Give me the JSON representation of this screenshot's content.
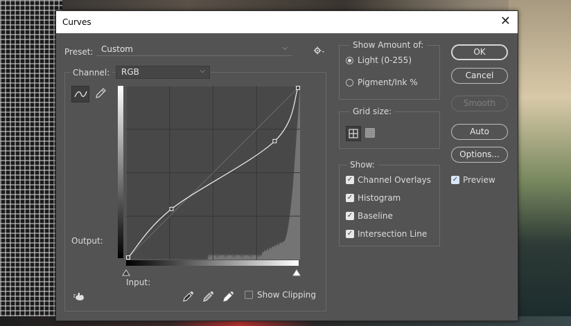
{
  "dialog": {
    "title": "Curves",
    "close_icon": "close-icon"
  },
  "preset": {
    "label": "Preset:",
    "value": "Custom",
    "settings_icon": "gear-icon"
  },
  "channel": {
    "label": "Channel:",
    "value": "RGB"
  },
  "curve": {
    "output_label": "Output:",
    "input_label": "Input:",
    "points": [
      [
        0,
        0
      ],
      [
        65,
        73
      ],
      [
        220,
        175
      ],
      [
        255,
        255
      ]
    ],
    "histogram_color": "#7d7d7d",
    "grid_divisions": 4,
    "tools": [
      "curve-point-tool-icon",
      "pencil-icon"
    ],
    "eyedroppers": [
      "black-eyedropper-icon",
      "gray-eyedropper-icon",
      "white-eyedropper-icon"
    ],
    "target_adjust_icon": "hand-adjust-icon",
    "show_clipping_label": "Show Clipping"
  },
  "show_amount": {
    "title": "Show Amount of:",
    "options": [
      "Light  (0-255)",
      "Pigment/Ink %"
    ],
    "selected": 0
  },
  "grid_size": {
    "title": "Grid size:",
    "options": [
      "simple-grid-icon",
      "detailed-grid-icon"
    ],
    "selected": 0
  },
  "show": {
    "title": "Show:",
    "items": [
      "Channel Overlays",
      "Histogram",
      "Baseline",
      "Intersection Line"
    ]
  },
  "buttons": {
    "ok": "OK",
    "cancel": "Cancel",
    "smooth": "Smooth",
    "auto": "Auto",
    "options": "Options..."
  },
  "preview": {
    "label": "Preview",
    "checked": true
  }
}
